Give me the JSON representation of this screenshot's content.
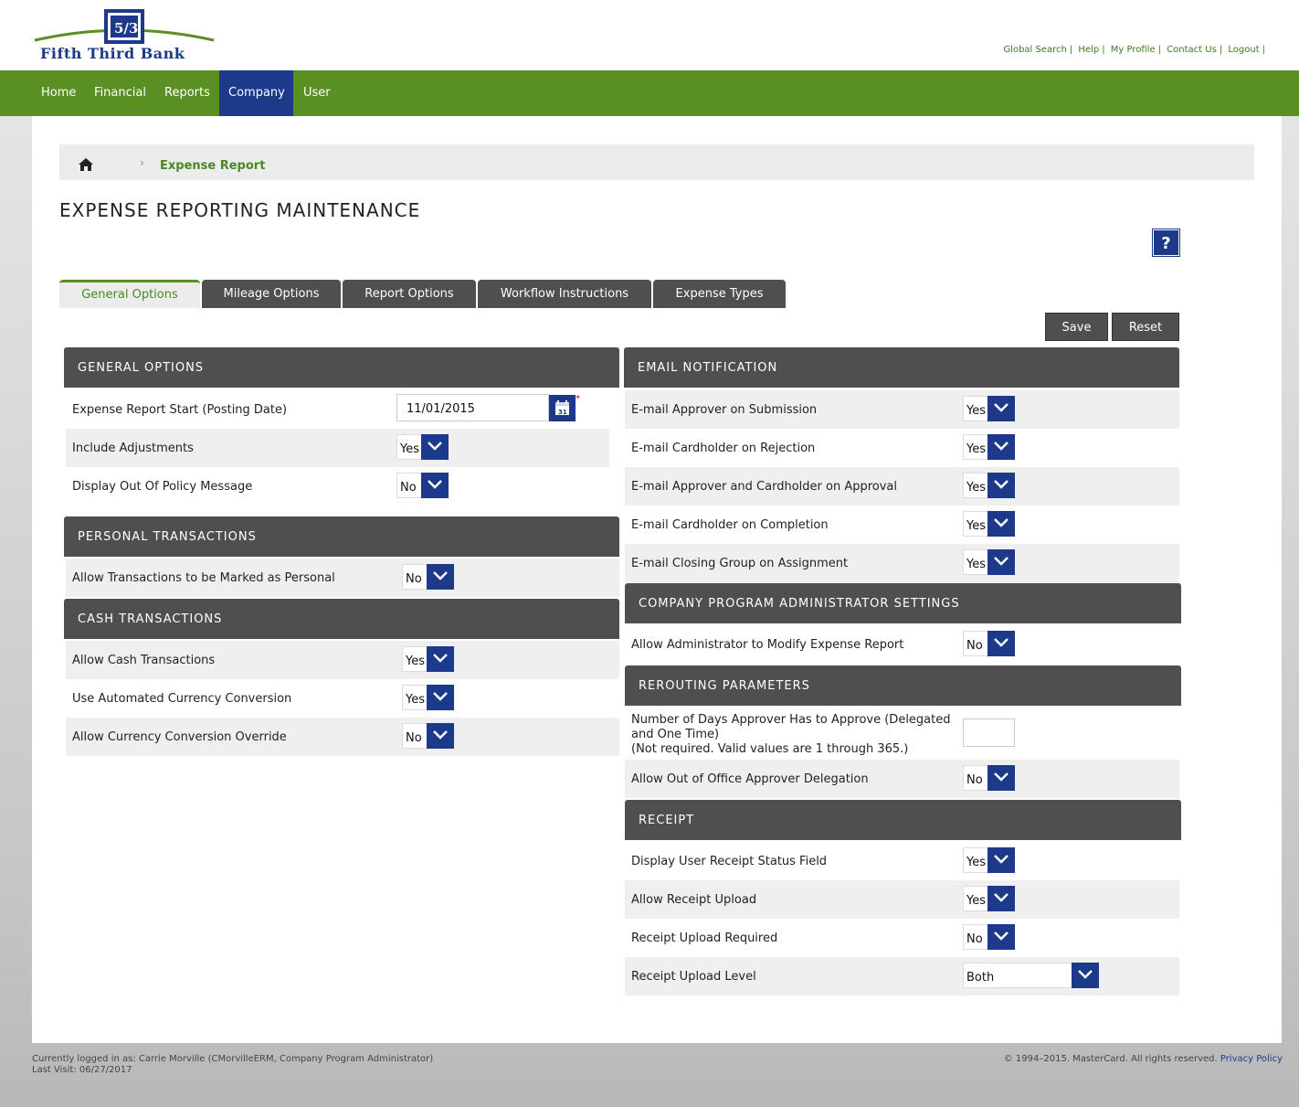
{
  "brand": {
    "name": "Fifth Third Bank",
    "logo_icon": "fifth-third-logo",
    "accent": "#5a8f23",
    "navy": "#1d3a8a"
  },
  "util_links": [
    "Global Search",
    "Help",
    "My Profile",
    "Contact Us",
    "Logout"
  ],
  "nav": [
    "Home",
    "Financial",
    "Reports",
    "Company",
    "User"
  ],
  "breadcrumb": {
    "home_icon": "home-icon",
    "chevron": "›",
    "current": "Expense Report"
  },
  "page_title": "EXPENSE REPORTING MAINTENANCE",
  "help_label": "?",
  "tabs": [
    "General Options",
    "Mileage Options",
    "Report Options",
    "Workflow Instructions",
    "Expense Types"
  ],
  "buttons": {
    "save": "Save",
    "reset": "Reset"
  },
  "general": {
    "title": "GENERAL OPTIONS",
    "rows": [
      {
        "label": "Expense Report Start (Posting Date)",
        "value": "11/01/2015"
      },
      {
        "label": "Include Adjustments",
        "value": "Yes"
      },
      {
        "label": "Display Out Of Policy Message",
        "value": "No"
      }
    ],
    "required_mark": "*",
    "cal_day": "31"
  },
  "personal": {
    "title": "PERSONAL TRANSACTIONS",
    "rows": [
      {
        "label": "Allow Transactions to be Marked as Personal",
        "value": "No"
      }
    ]
  },
  "cash": {
    "title": "CASH TRANSACTIONS",
    "rows": [
      {
        "label": "Allow Cash Transactions",
        "value": "Yes"
      },
      {
        "label": "Use Automated Currency Conversion",
        "value": "Yes"
      },
      {
        "label": "Allow Currency Conversion Override",
        "value": "No"
      }
    ]
  },
  "email": {
    "title": "EMAIL NOTIFICATION",
    "rows": [
      {
        "label": "E-mail Approver on Submission",
        "value": "Yes"
      },
      {
        "label": "E-mail Cardholder on Rejection",
        "value": "Yes"
      },
      {
        "label": "E-mail Approver and Cardholder on Approval",
        "value": "Yes"
      },
      {
        "label": "E-mail Cardholder on Completion",
        "value": "Yes"
      },
      {
        "label": "E-mail Closing Group on Assignment",
        "value": "Yes"
      }
    ]
  },
  "admin": {
    "title": "COMPANY PROGRAM ADMINISTRATOR SETTINGS",
    "rows": [
      {
        "label": "Allow Administrator to Modify Expense Report",
        "value": "No"
      }
    ]
  },
  "rerouting": {
    "title": "REROUTING PARAMETERS",
    "days_label_1": "Number of Days Approver Has to Approve (Delegated",
    "days_label_2": "and One Time)",
    "days_label_3": "(Not required. Valid values are 1 through 365.)",
    "days_value": "",
    "ooo_label": "Allow Out of Office Approver Delegation",
    "ooo_value": "No"
  },
  "receipt": {
    "title": "RECEIPT",
    "rows": [
      {
        "label": "Display User Receipt Status Field",
        "value": "Yes"
      },
      {
        "label": "Allow Receipt Upload",
        "value": "Yes"
      },
      {
        "label": "Receipt Upload Required",
        "value": "No"
      },
      {
        "label": "Receipt Upload Level",
        "value": "Both"
      }
    ]
  },
  "footer": {
    "logged_in": "Currently logged in as: Carrie Morville (CMorvilleERM, Company Program Administrator)",
    "last_visit": "Last Visit: 06/27/2017",
    "copyright": "© 1994–2015. MasterCard. All rights reserved.",
    "privacy": "Privacy Policy"
  }
}
